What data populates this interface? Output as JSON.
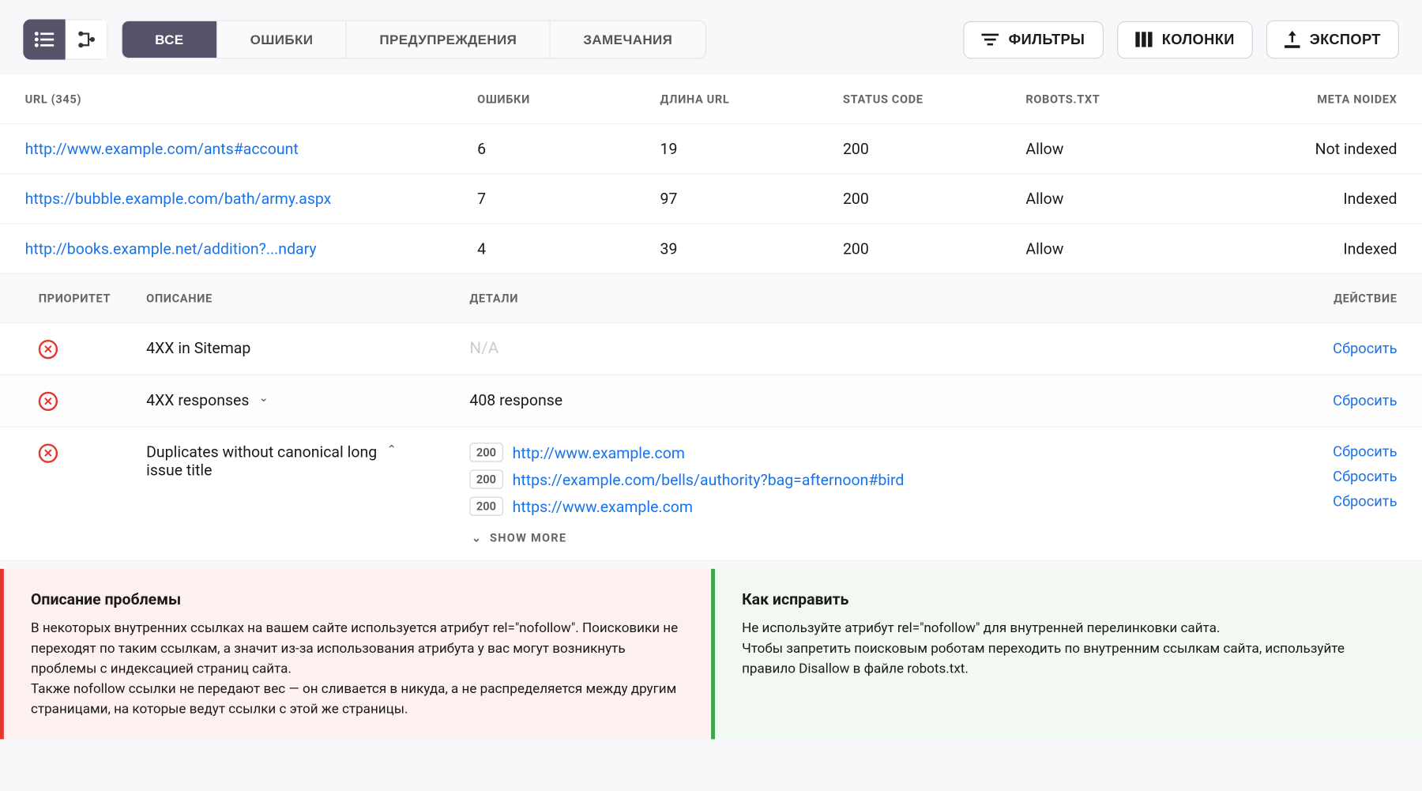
{
  "toolbar": {
    "tabs": [
      "ВСЕ",
      "ОШИБКИ",
      "ПРЕДУПРЕЖДЕНИЯ",
      "ЗАМЕЧАНИЯ"
    ],
    "filters_label": "ФИЛЬТРЫ",
    "columns_label": "КОЛОНКИ",
    "export_label": "ЭКСПОРТ"
  },
  "table": {
    "headers": {
      "url": "URL (345)",
      "errors": "ОШИБКИ",
      "url_length": "ДЛИНА URL",
      "status": "STATUS CODE",
      "robots": "ROBOTS.TXT",
      "meta": "META NOIDEX"
    },
    "rows": [
      {
        "url": "http://www.example.com/ants#account",
        "errors": "6",
        "url_length": "19",
        "status": "200",
        "robots": "Allow",
        "meta": "Not indexed"
      },
      {
        "url": "https://bubble.example.com/bath/army.aspx",
        "errors": "7",
        "url_length": "97",
        "status": "200",
        "robots": "Allow",
        "meta": "Indexed"
      },
      {
        "url": "http://books.example.net/addition?...ndary",
        "errors": "4",
        "url_length": "39",
        "status": "200",
        "robots": "Allow",
        "meta": "Indexed"
      }
    ]
  },
  "sub_table": {
    "headers": {
      "priority": "ПРИОРИТЕТ",
      "description": "ОПИСАНИЕ",
      "details": "ДЕТАЛИ",
      "action": "ДЕЙСТВИЕ"
    },
    "rows": [
      {
        "desc": "4XX in Sitemap",
        "details_na": "N/A",
        "action": "Сбросить"
      },
      {
        "desc": "4XX responses",
        "detail_text": "408 response",
        "action": "Сбросить",
        "expandable": true,
        "expanded": false
      },
      {
        "desc": "Duplicates without canonical long issue title",
        "expandable": true,
        "expanded": true,
        "details": [
          {
            "status": "200",
            "url": "http://www.example.com"
          },
          {
            "status": "200",
            "url": "https://example.com/bells/authority?bag=afternoon#bird"
          },
          {
            "status": "200",
            "url": "https://www.example.com"
          }
        ],
        "action": "Сбросить",
        "show_more": "SHOW MORE"
      }
    ]
  },
  "help": {
    "problem": {
      "title": "Описание проблемы",
      "body": "В некоторых внутренних ссылках на вашем сайте используется атрибут rel=\"nofollow\". Поисковики не переходят по таким ссылкам, а значит из-за использования атрибута у вас могут возникнуть проблемы с индексацией страниц сайта.\nТакже nofollow ссылки не передают вес — он сливается в никуда, а не распределяется между другим страницами, на которые ведут ссылки с этой же страницы."
    },
    "fix": {
      "title": "Как исправить",
      "body": "Не используйте атрибут rel=\"nofollow\" для внутренней перелинковки сайта.\nЧтобы запретить поисковым роботам переходить по внутренним ссылкам сайта, используйте правило Disallow в файле robots.txt."
    }
  }
}
